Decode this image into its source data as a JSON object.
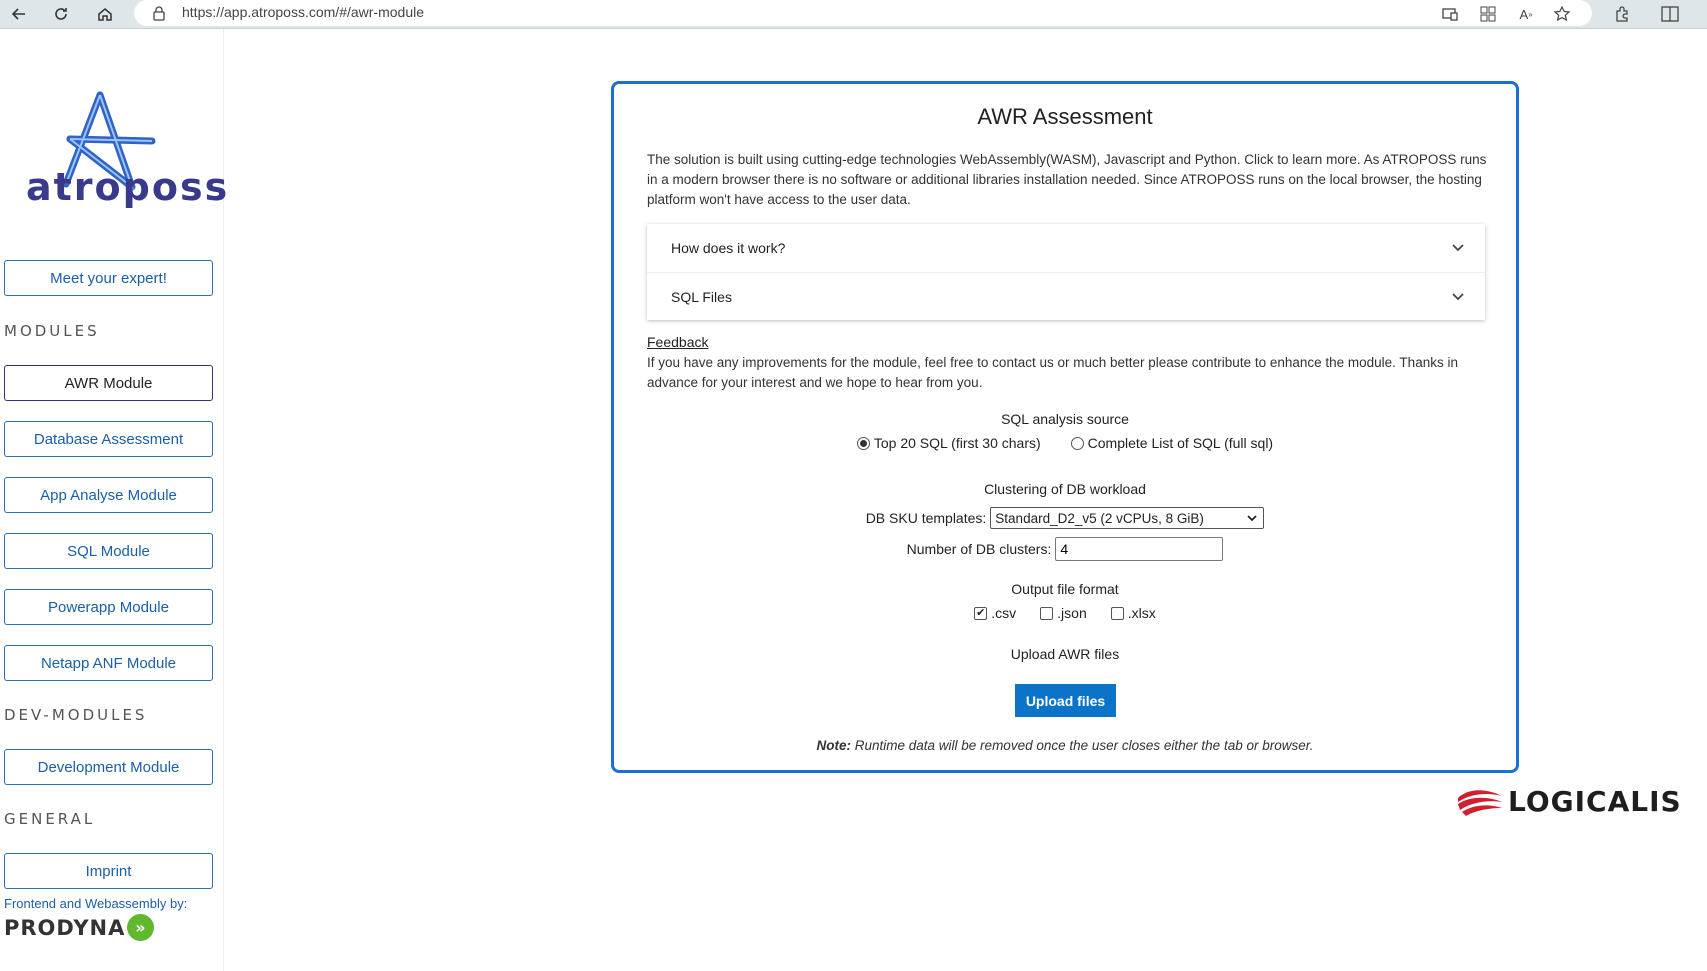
{
  "browser": {
    "url": "https://app.atroposs.com/#/awr-module"
  },
  "sidebar": {
    "logo_text": "atroposs",
    "meet_expert": "Meet your expert!",
    "section_modules": "MODULES",
    "modules": [
      {
        "label": "AWR Module"
      },
      {
        "label": "Database Assessment"
      },
      {
        "label": "App Analyse Module"
      },
      {
        "label": "SQL Module"
      },
      {
        "label": "Powerapp Module"
      },
      {
        "label": "Netapp ANF Module"
      }
    ],
    "section_dev": "DEV-MODULES",
    "dev_modules": [
      {
        "label": "Development Module"
      }
    ],
    "section_general": "GENERAL",
    "general": [
      {
        "label": "Imprint"
      }
    ],
    "footer_note": "Frontend and Webassembly by:",
    "footer_brand": "PRODYNA"
  },
  "card": {
    "title": "AWR Assessment",
    "intro": "The solution is built using cutting-edge technologies WebAssembly(WASM), Javascript and Python. Click to learn more. As ATROPOSS runs in a modern browser there is no software or additional libraries installation needed. Since ATROPOSS runs on the local browser, the hosting platform won't have access to the user data.",
    "accordion": [
      {
        "label": "How does it work?"
      },
      {
        "label": "SQL Files"
      }
    ],
    "feedback_title": "Feedback",
    "feedback_text": "If you have any improvements for the module, feel free to contact us or much better please contribute to enhance the module. Thanks in advance for your interest and we hope to hear from you.",
    "sql_source_label": "SQL analysis source",
    "sql_source_options": [
      {
        "label": "Top 20 SQL (first 30 chars)",
        "selected": true
      },
      {
        "label": "Complete List of SQL (full sql)",
        "selected": false
      }
    ],
    "clustering_label": "Clustering of DB workload",
    "sku_label": "DB SKU templates:",
    "sku_value": "Standard_D2_v5 (2 vCPUs, 8 GiB)",
    "clusters_label": "Number of DB clusters:",
    "clusters_value": "4",
    "output_label": "Output file format",
    "output_options": [
      {
        "label": ".csv",
        "checked": true
      },
      {
        "label": ".json",
        "checked": false
      },
      {
        "label": ".xlsx",
        "checked": false
      }
    ],
    "upload_label": "Upload AWR files",
    "upload_button": "Upload files",
    "note_bold": "Note:",
    "note_text": " Runtime data will be removed once the user closes either the tab or browser."
  },
  "partner": {
    "logo_text": "LOGICALIS"
  },
  "colors": {
    "accent": "#1a6fd0",
    "button": "#0b74c9",
    "logo": "#3a3a8c"
  }
}
